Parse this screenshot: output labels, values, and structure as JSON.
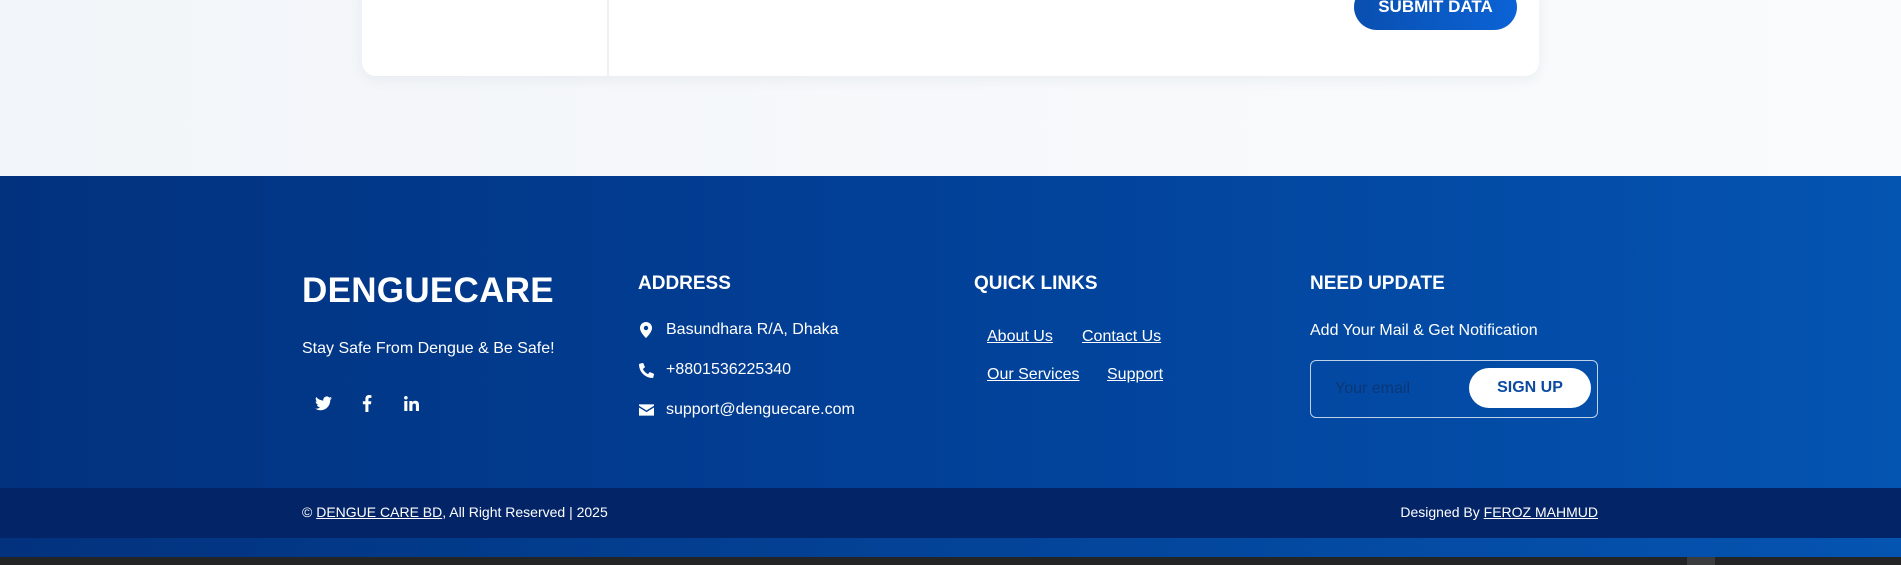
{
  "form": {
    "submit_label": "SUBMIT DATA"
  },
  "footer": {
    "brand": {
      "name": "DENGUECARE",
      "tagline": "Stay Safe From Dengue & Be Safe!"
    },
    "socials": [
      {
        "icon": "twitter-icon"
      },
      {
        "icon": "facebook-icon"
      },
      {
        "icon": "linkedin-icon"
      }
    ],
    "address": {
      "title": "ADDRESS",
      "location": "Basundhara R/A, Dhaka",
      "phone": "+8801536225340",
      "email": "support@denguecare.com"
    },
    "quick_links": {
      "title": "QUICK LINKS",
      "about": "About Us",
      "contact": "Contact Us",
      "services": "Our Services",
      "support": "Support"
    },
    "newsletter": {
      "title": "NEED UPDATE",
      "text": "Add Your Mail & Get Notification",
      "placeholder": "Your email",
      "button": "SIGN UP"
    }
  },
  "bottom_bar": {
    "copyright_symbol": "©",
    "company_link": "DENGUE CARE BD",
    "rights_text": ", All Right Reserved | 2025",
    "designed_by": "Designed By",
    "designer_link": "FEROZ MAHMUD"
  },
  "colors": {
    "footer_start": "#02327e",
    "footer_end": "#0454b1",
    "bottom_bar": "#032568",
    "accent": "#0b63d6"
  }
}
